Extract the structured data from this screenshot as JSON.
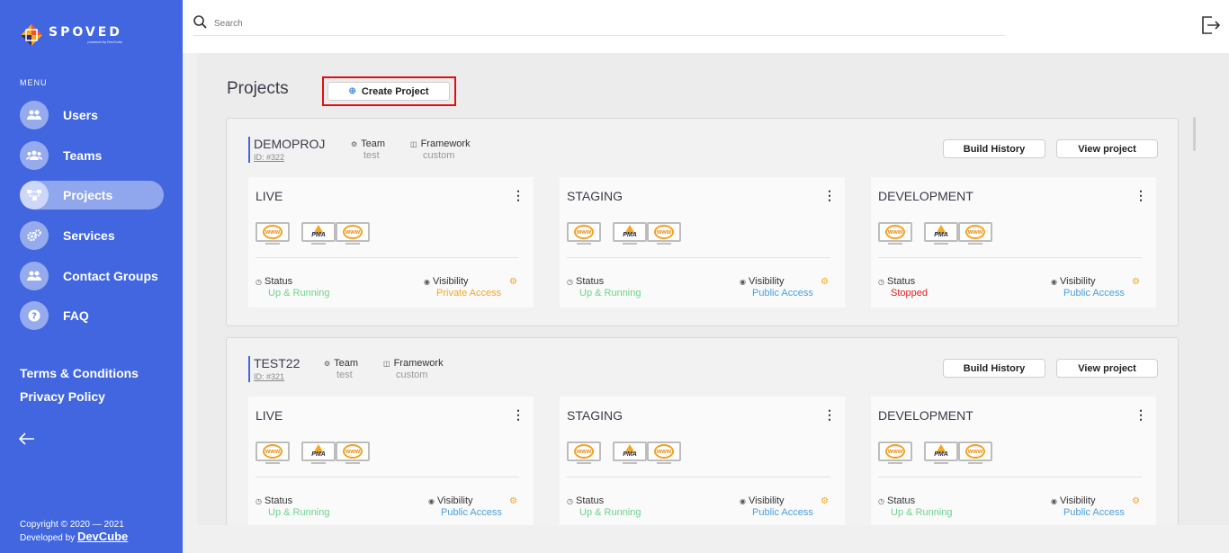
{
  "brand": {
    "name": "SPOVED",
    "tagline": "powered by DevCube",
    "colors": {
      "primary": "#4166e0",
      "accent_orange": "#f5a623",
      "ok_green": "#6dd38b",
      "stopped_red": "#e02020",
      "link_blue": "#4a9fe0"
    }
  },
  "sidebar": {
    "menu_label": "MENU",
    "items": [
      {
        "label": "Users",
        "icon": "users-icon",
        "active": false
      },
      {
        "label": "Teams",
        "icon": "teams-icon",
        "active": false
      },
      {
        "label": "Projects",
        "icon": "projects-icon",
        "active": true
      },
      {
        "label": "Services",
        "icon": "services-icon",
        "active": false
      },
      {
        "label": "Contact Groups",
        "icon": "contact-groups-icon",
        "active": false
      },
      {
        "label": "FAQ",
        "icon": "faq-icon",
        "active": false
      }
    ],
    "links": {
      "terms": "Terms & Conditions",
      "privacy": "Privacy Policy"
    },
    "copyright_line1": "Copyright © 2020 — 2021",
    "copyright_line2": "Developed by ",
    "copyright_company": "DevCube"
  },
  "topbar": {
    "search_placeholder": "Search"
  },
  "page": {
    "title": "Projects",
    "create_button": "Create Project"
  },
  "labels": {
    "team": "Team",
    "framework": "Framework",
    "status": "Status",
    "visibility": "Visibility",
    "build_history": "Build History",
    "view_project": "View project"
  },
  "projects": [
    {
      "name": "DEMOPROJ",
      "id": "ID: #322",
      "team": "test",
      "framework": "custom",
      "environments": [
        {
          "name": "LIVE",
          "status": "Up & Running",
          "visibility": "Private Access"
        },
        {
          "name": "STAGING",
          "status": "Up & Running",
          "visibility": "Public Access"
        },
        {
          "name": "DEVELOPMENT",
          "status": "Stopped",
          "visibility": "Public Access"
        }
      ]
    },
    {
      "name": "TEST22",
      "id": "ID: #321",
      "team": "test",
      "framework": "custom",
      "environments": [
        {
          "name": "LIVE",
          "status": "Up & Running",
          "visibility": "Public Access"
        },
        {
          "name": "STAGING",
          "status": "Up & Running",
          "visibility": "Public Access"
        },
        {
          "name": "DEVELOPMENT",
          "status": "Up & Running",
          "visibility": "Public Access"
        }
      ]
    }
  ],
  "env_icons": {
    "www": "www",
    "pma": "PMA"
  }
}
